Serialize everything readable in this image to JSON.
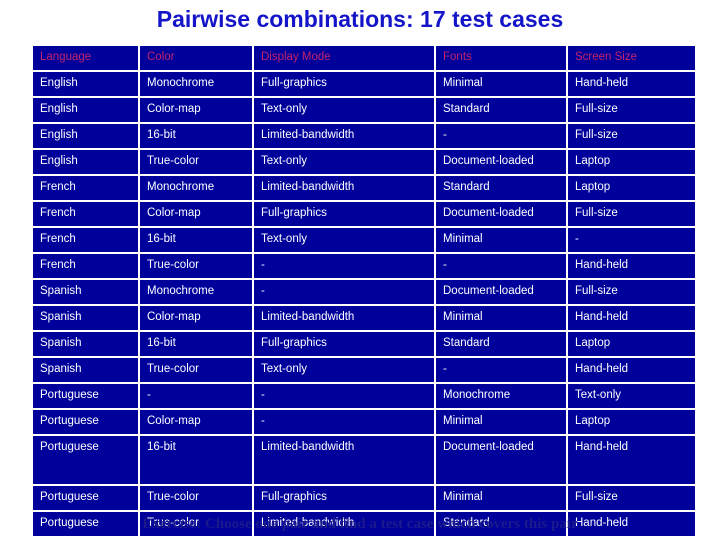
{
  "slide": {
    "title": "Pairwise combinations: 17 test cases",
    "footer": "Exercise: Choose one pair and find a test case which covers this pair",
    "colors": {
      "title_blue": "#1414C8",
      "cell_background": "#00009B",
      "cell_text": "#FFFFFF",
      "header_text": "#C2256B",
      "footer_blue": "#1A1A8C",
      "page_background": "#FFFFFF"
    }
  },
  "table": {
    "headers": [
      "Language",
      "Color",
      "Display Mode",
      "Fonts",
      "Screen Size"
    ],
    "row_count": 17,
    "rows": [
      {
        "language": "English",
        "color": "Monochrome",
        "display_mode": "Full-graphics",
        "fonts": "Minimal",
        "screen_size": "Hand-held",
        "tall": false
      },
      {
        "language": "English",
        "color": "Color-map",
        "display_mode": "Text-only",
        "fonts": "Standard",
        "screen_size": "Full-size",
        "tall": false
      },
      {
        "language": "English",
        "color": "16-bit",
        "display_mode": "Limited-bandwidth",
        "fonts": "-",
        "screen_size": "Full-size",
        "tall": false
      },
      {
        "language": "English",
        "color": "True-color",
        "display_mode": "Text-only",
        "fonts": "Document-loaded",
        "screen_size": "Laptop",
        "tall": false
      },
      {
        "language": "French",
        "color": "Monochrome",
        "display_mode": "Limited-bandwidth",
        "fonts": "Standard",
        "screen_size": "Laptop",
        "tall": false
      },
      {
        "language": "French",
        "color": "Color-map",
        "display_mode": "Full-graphics",
        "fonts": "Document-loaded",
        "screen_size": "Full-size",
        "tall": false
      },
      {
        "language": "French",
        "color": "16-bit",
        "display_mode": "Text-only",
        "fonts": "Minimal",
        "screen_size": "-",
        "tall": false
      },
      {
        "language": "French",
        "color": "True-color",
        "display_mode": "-",
        "fonts": "-",
        "screen_size": "Hand-held",
        "tall": false
      },
      {
        "language": "Spanish",
        "color": "Monochrome",
        "display_mode": "-",
        "fonts": "Document-loaded",
        "screen_size": "Full-size",
        "tall": false
      },
      {
        "language": "Spanish",
        "color": "Color-map",
        "display_mode": "Limited-bandwidth",
        "fonts": "Minimal",
        "screen_size": "Hand-held",
        "tall": false
      },
      {
        "language": "Spanish",
        "color": "16-bit",
        "display_mode": "Full-graphics",
        "fonts": "Standard",
        "screen_size": "Laptop",
        "tall": false
      },
      {
        "language": "Spanish",
        "color": "True-color",
        "display_mode": "Text-only",
        "fonts": "-",
        "screen_size": "Hand-held",
        "tall": false
      },
      {
        "language": "Portuguese",
        "color": "-",
        "display_mode": "-",
        "fonts": "Monochrome",
        "screen_size": "Text-only",
        "tall": false
      },
      {
        "language": "Portuguese",
        "color": "Color-map",
        "display_mode": "-",
        "fonts": "Minimal",
        "screen_size": "Laptop",
        "tall": false
      },
      {
        "language": "Portuguese",
        "color": "16-bit",
        "display_mode": "Limited-bandwidth",
        "fonts": "Document-loaded",
        "screen_size": "Hand-held",
        "tall": true
      },
      {
        "language": "Portuguese",
        "color": "True-color",
        "display_mode": "Full-graphics",
        "fonts": "Minimal",
        "screen_size": "Full-size",
        "tall": false
      },
      {
        "language": "Portuguese",
        "color": "True-color",
        "display_mode": "Limited-bandwidth",
        "fonts": "Standard",
        "screen_size": "Hand-held",
        "tall": false
      }
    ]
  }
}
